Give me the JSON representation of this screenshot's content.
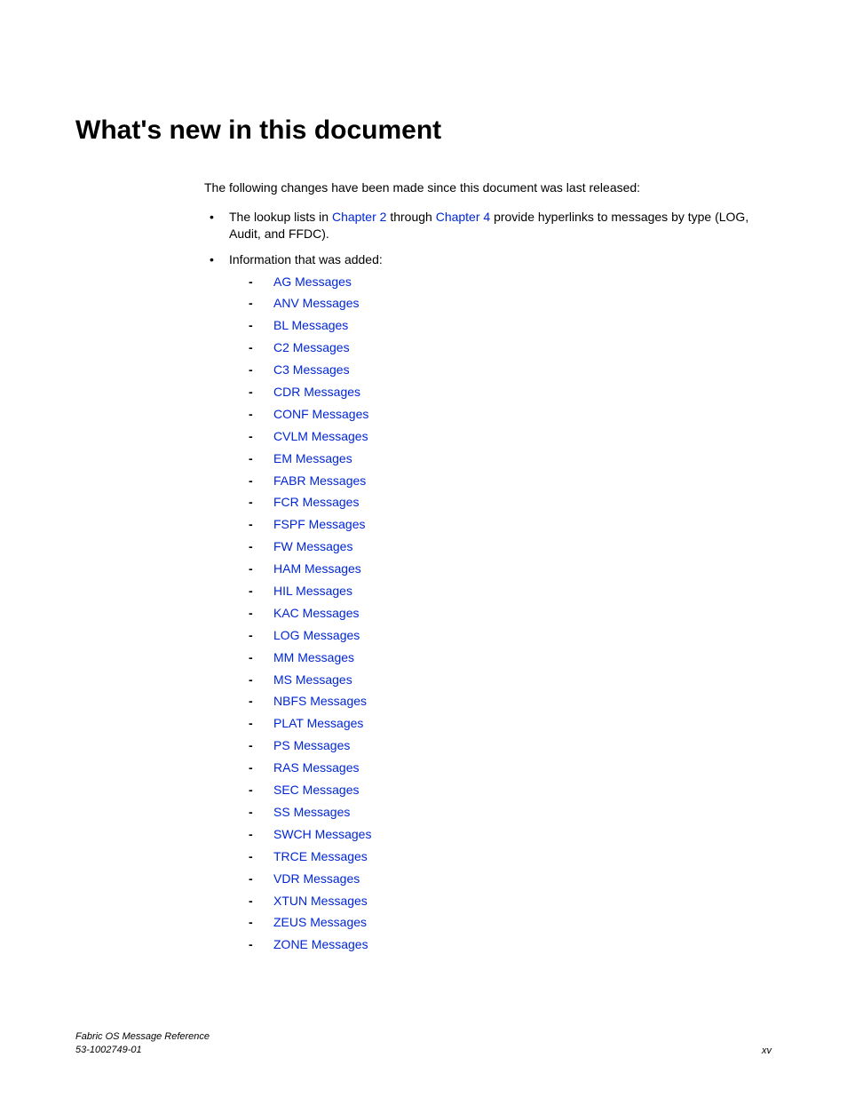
{
  "heading": "What's new in this document",
  "intro": "The following changes have been made since this document was last released:",
  "bullet1": {
    "prefix": "The lookup lists in ",
    "link1": "Chapter 2",
    "mid": " through ",
    "link2": "Chapter 4",
    "suffix": " provide hyperlinks to messages by type (LOG, Audit, and FFDC)."
  },
  "bullet2_label": "Information that was added:",
  "sublist": [
    "AG Messages",
    "ANV Messages",
    "BL Messages",
    "C2 Messages",
    "C3 Messages",
    "CDR Messages",
    "CONF Messages",
    "CVLM Messages",
    "EM Messages",
    "FABR Messages",
    "FCR Messages",
    "FSPF Messages",
    "FW Messages",
    "HAM Messages",
    "HIL Messages",
    "KAC Messages",
    "LOG Messages",
    "MM Messages",
    "MS Messages",
    "NBFS Messages",
    "PLAT Messages",
    "PS Messages",
    "RAS Messages",
    "SEC Messages",
    "SS Messages",
    "SWCH Messages",
    "TRCE Messages",
    "VDR Messages",
    "XTUN Messages",
    "ZEUS Messages",
    "ZONE Messages"
  ],
  "footer": {
    "title": "Fabric OS Message Reference",
    "docnum": "53-1002749-01",
    "pagenum": "xv"
  }
}
